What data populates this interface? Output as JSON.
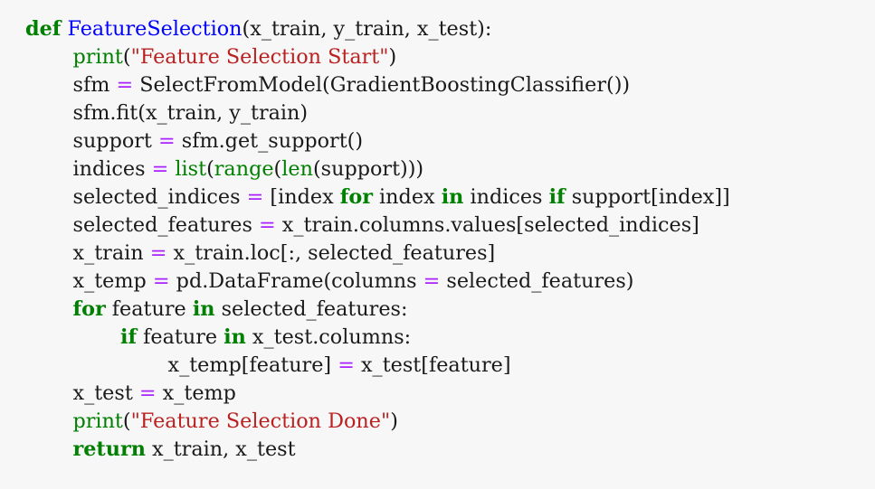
{
  "colors": {
    "background": "#f7f7f7",
    "text": "#1a1a1a",
    "keyword": "#008000",
    "function_name": "#0000ff",
    "builtin": "#008000",
    "string": "#ba2121",
    "operator": "#aa22ff"
  },
  "code": {
    "language": "python",
    "lines": [
      {
        "indent": 0,
        "tokens": [
          {
            "t": "kw",
            "v": "def"
          },
          {
            "t": "pl",
            "v": " "
          },
          {
            "t": "fn",
            "v": "FeatureSelection"
          },
          {
            "t": "pl",
            "v": "(x_train, y_train, x_test):"
          }
        ]
      },
      {
        "indent": 1,
        "tokens": [
          {
            "t": "bi",
            "v": "print"
          },
          {
            "t": "pl",
            "v": "("
          },
          {
            "t": "str",
            "v": "\"Feature Selection Start\""
          },
          {
            "t": "pl",
            "v": ")"
          }
        ]
      },
      {
        "indent": 1,
        "tokens": [
          {
            "t": "pl",
            "v": "sfm "
          },
          {
            "t": "op",
            "v": "="
          },
          {
            "t": "pl",
            "v": " SelectFromModel(GradientBoostingClassifier())"
          }
        ]
      },
      {
        "indent": 1,
        "tokens": [
          {
            "t": "pl",
            "v": "sfm.fit(x_train, y_train)"
          }
        ]
      },
      {
        "indent": 1,
        "tokens": [
          {
            "t": "pl",
            "v": "support "
          },
          {
            "t": "op",
            "v": "="
          },
          {
            "t": "pl",
            "v": " sfm.get_support()"
          }
        ]
      },
      {
        "indent": 1,
        "tokens": [
          {
            "t": "pl",
            "v": "indices "
          },
          {
            "t": "op",
            "v": "="
          },
          {
            "t": "pl",
            "v": " "
          },
          {
            "t": "bi",
            "v": "list"
          },
          {
            "t": "pl",
            "v": "("
          },
          {
            "t": "bi",
            "v": "range"
          },
          {
            "t": "pl",
            "v": "("
          },
          {
            "t": "bi",
            "v": "len"
          },
          {
            "t": "pl",
            "v": "(support)))"
          }
        ]
      },
      {
        "indent": 1,
        "tokens": [
          {
            "t": "pl",
            "v": "selected_indices "
          },
          {
            "t": "op",
            "v": "="
          },
          {
            "t": "pl",
            "v": " [index "
          },
          {
            "t": "kw",
            "v": "for"
          },
          {
            "t": "pl",
            "v": " index "
          },
          {
            "t": "kw",
            "v": "in"
          },
          {
            "t": "pl",
            "v": " indices "
          },
          {
            "t": "kw",
            "v": "if"
          },
          {
            "t": "pl",
            "v": " support[index]]"
          }
        ]
      },
      {
        "indent": 1,
        "tokens": [
          {
            "t": "pl",
            "v": "selected_features "
          },
          {
            "t": "op",
            "v": "="
          },
          {
            "t": "pl",
            "v": " x_train.columns.values[selected_indices]"
          }
        ]
      },
      {
        "indent": 1,
        "tokens": [
          {
            "t": "pl",
            "v": "x_train "
          },
          {
            "t": "op",
            "v": "="
          },
          {
            "t": "pl",
            "v": " x_train.loc[:, selected_features]"
          }
        ]
      },
      {
        "indent": 1,
        "tokens": [
          {
            "t": "pl",
            "v": "x_temp "
          },
          {
            "t": "op",
            "v": "="
          },
          {
            "t": "pl",
            "v": " pd.DataFrame(columns "
          },
          {
            "t": "op",
            "v": "="
          },
          {
            "t": "pl",
            "v": " selected_features)"
          }
        ]
      },
      {
        "indent": 1,
        "tokens": [
          {
            "t": "kw",
            "v": "for"
          },
          {
            "t": "pl",
            "v": " feature "
          },
          {
            "t": "kw",
            "v": "in"
          },
          {
            "t": "pl",
            "v": " selected_features:"
          }
        ]
      },
      {
        "indent": 2,
        "tokens": [
          {
            "t": "kw",
            "v": "if"
          },
          {
            "t": "pl",
            "v": " feature "
          },
          {
            "t": "kw",
            "v": "in"
          },
          {
            "t": "pl",
            "v": " x_test.columns:"
          }
        ]
      },
      {
        "indent": 3,
        "tokens": [
          {
            "t": "pl",
            "v": "x_temp[feature] "
          },
          {
            "t": "op",
            "v": "="
          },
          {
            "t": "pl",
            "v": " x_test[feature]"
          }
        ]
      },
      {
        "indent": 1,
        "tokens": [
          {
            "t": "pl",
            "v": "x_test "
          },
          {
            "t": "op",
            "v": "="
          },
          {
            "t": "pl",
            "v": " x_temp"
          }
        ]
      },
      {
        "indent": 1,
        "tokens": [
          {
            "t": "bi",
            "v": "print"
          },
          {
            "t": "pl",
            "v": "("
          },
          {
            "t": "str",
            "v": "\"Feature Selection Done\""
          },
          {
            "t": "pl",
            "v": ")"
          }
        ]
      },
      {
        "indent": 1,
        "tokens": [
          {
            "t": "kw",
            "v": "return"
          },
          {
            "t": "pl",
            "v": " x_train, x_test"
          }
        ]
      }
    ]
  }
}
